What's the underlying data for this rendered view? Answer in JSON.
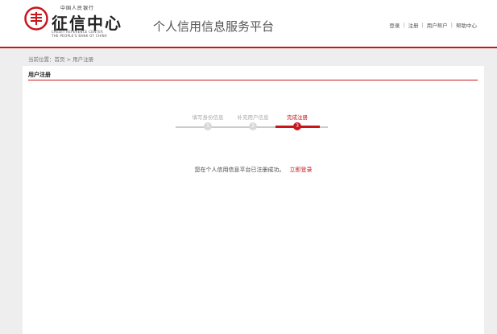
{
  "header": {
    "logo": {
      "bank_name": "中国人民银行",
      "center_name": "征信中心",
      "english_line1": "CREDIT REFERENCE CENTER",
      "english_line2": "THE PEOPLE'S BANK OF CHINA"
    },
    "platform_title": "个人信用信息服务平台",
    "links": [
      "登录",
      "注册",
      "用户帮户",
      "帮助中心"
    ]
  },
  "breadcrumb": "当前位置：首页 > 用户注册",
  "panel": {
    "title": "用户注册",
    "steps": [
      {
        "label": "填写身份信息",
        "number": "1",
        "state": "done"
      },
      {
        "label": "补充用户信息",
        "number": "2",
        "state": "done"
      },
      {
        "label": "完成注册",
        "number": "3",
        "state": "active"
      }
    ],
    "success_text": "您在个人信用信息平台已注册成功。",
    "login_link": "立即登录"
  },
  "colors": {
    "accent": "#c8161d",
    "background": "#eeeeee",
    "step_done": "#d9d9d9"
  }
}
